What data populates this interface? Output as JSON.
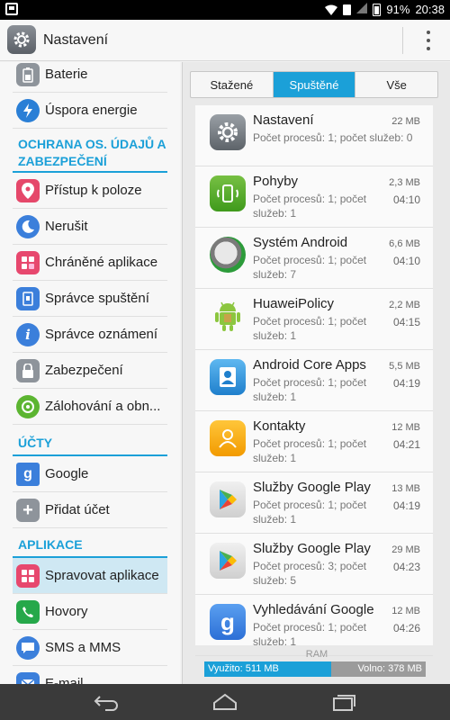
{
  "status_bar": {
    "battery": "91%",
    "time": "20:38"
  },
  "action_bar": {
    "title": "Nastavení"
  },
  "sidebar": {
    "items_top": [
      {
        "label": "Baterie",
        "icon": "battery-icon",
        "color": "#8e949b"
      },
      {
        "label": "Úspora energie",
        "icon": "energy-saving-icon",
        "color": "#2a7fd6"
      }
    ],
    "section_privacy": "OCHRANA OS. ÚDAJŮ A ZABEZPEČENÍ",
    "items_privacy": [
      {
        "label": "Přístup k poloze",
        "icon": "location-icon",
        "color": "#e5486a"
      },
      {
        "label": "Nerušit",
        "icon": "moon-icon",
        "color": "#3b7fdb"
      },
      {
        "label": "Chráněné aplikace",
        "icon": "protected-apps-icon",
        "color": "#e7486e"
      },
      {
        "label": "Správce spuštění",
        "icon": "startup-manager-icon",
        "color": "#3b7fdb"
      },
      {
        "label": "Správce oznámení",
        "icon": "notification-manager-icon",
        "color": "#3b7fdb"
      },
      {
        "label": "Zabezpečení",
        "icon": "lock-icon",
        "color": "#8e949b"
      },
      {
        "label": "Zálohování a obn...",
        "icon": "backup-icon",
        "color": "#5cb531"
      }
    ],
    "section_accounts": "ÚČTY",
    "items_accounts": [
      {
        "label": "Google",
        "icon": "google-icon",
        "color": "#3b7fdb"
      },
      {
        "label": "Přidat účet",
        "icon": "plus-icon",
        "color": "#8e949b"
      }
    ],
    "section_apps": "APLIKACE",
    "items_apps": [
      {
        "label": "Spravovat aplikace",
        "icon": "apps-icon",
        "color": "#e7486e"
      },
      {
        "label": "Hovory",
        "icon": "phone-icon",
        "color": "#26a84a"
      },
      {
        "label": "SMS a MMS",
        "icon": "sms-icon",
        "color": "#3b7fdb"
      },
      {
        "label": "E-mail",
        "icon": "email-icon",
        "color": "#3b7fdb"
      }
    ]
  },
  "tabs": [
    "Stažené",
    "Spuštěné",
    "Vše"
  ],
  "active_tab": "Spuštěné",
  "apps": [
    {
      "name": "Nastavení",
      "size": "22 MB",
      "desc": "Počet procesů: 1; počet služeb: 0",
      "time": "",
      "icon": "settings-icon"
    },
    {
      "name": "Pohyby",
      "size": "2,3 MB",
      "desc": "Počet procesů: 1; počet služeb: 1",
      "time": "04:10",
      "icon": "motion-icon"
    },
    {
      "name": "Systém Android",
      "size": "6,6 MB",
      "desc": "Počet procesů: 1; počet služeb: 7",
      "time": "04:10",
      "icon": "android-system-icon"
    },
    {
      "name": "HuaweiPolicy",
      "size": "2,2 MB",
      "desc": "Počet procesů: 1; počet služeb: 1",
      "time": "04:15",
      "icon": "android-robot-icon"
    },
    {
      "name": "Android Core Apps",
      "size": "5,5 MB",
      "desc": "Počet procesů: 1; počet služeb: 1",
      "time": "04:19",
      "icon": "contacts-book-icon"
    },
    {
      "name": "Kontakty",
      "size": "12 MB",
      "desc": "Počet procesů: 1; počet služeb: 1",
      "time": "04:21",
      "icon": "contacts-icon"
    },
    {
      "name": "Služby Google Play",
      "size": "13 MB",
      "desc": "Počet procesů: 1; počet služeb: 1",
      "time": "04:19",
      "icon": "google-play-icon"
    },
    {
      "name": "Služby Google Play",
      "size": "29 MB",
      "desc": "Počet procesů: 3; počet služeb: 5",
      "time": "04:23",
      "icon": "google-play-icon"
    },
    {
      "name": "Vyhledávání Google",
      "size": "12 MB",
      "desc": "Počet procesů: 1; počet služeb: 1",
      "time": "04:26",
      "icon": "google-search-icon"
    }
  ],
  "ram": {
    "label": "RAM",
    "used_text": "Využito: 511 MB",
    "free_text": "Volno: 378 MB",
    "used_fraction": 0.575
  },
  "colors": {
    "accent": "#1ba0d8"
  }
}
